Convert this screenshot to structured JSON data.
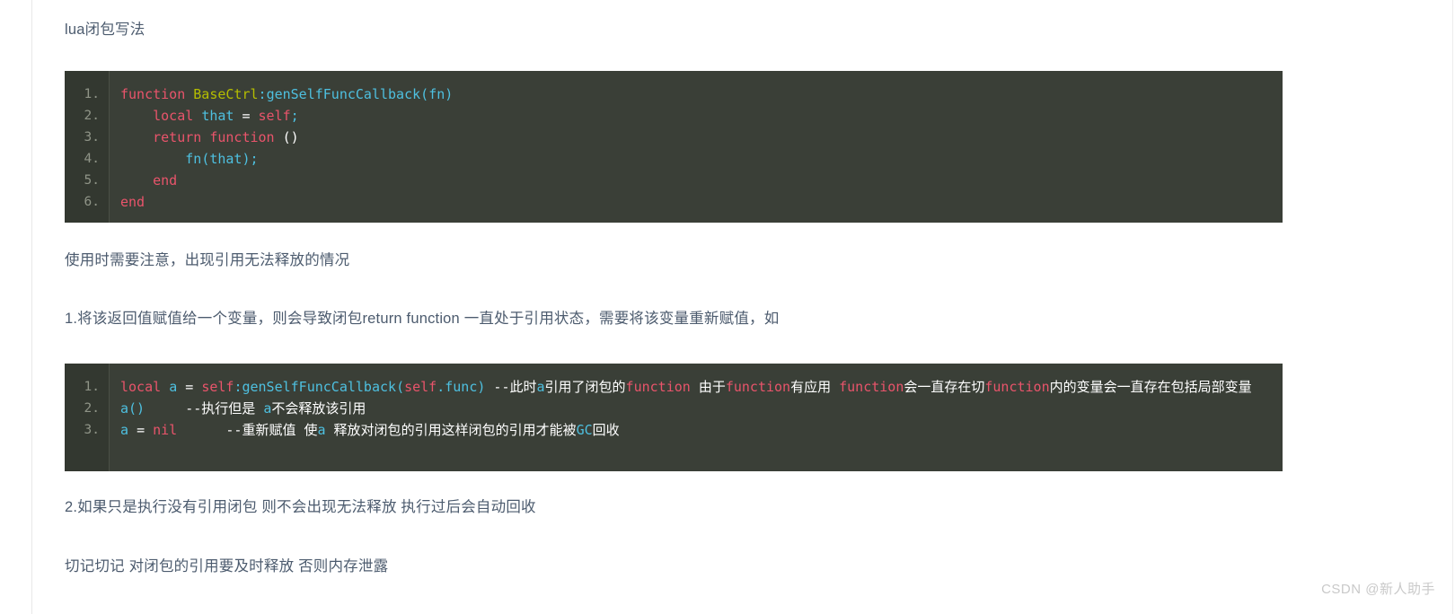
{
  "page": {
    "title": "lua闭包写法",
    "background": "#ffffff",
    "text_color": "#4c5b6e"
  },
  "paragraphs": {
    "title": "lua闭包写法",
    "note": "使用时需要注意，出现引用无法释放的情况",
    "item1": "1.将该返回值赋值给一个变量，则会导致闭包return function 一直处于引用状态，需要将该变量重新赋值，如",
    "item2": "2.如果只是执行没有引用闭包 则不会出现无法释放 执行过后会自动回收",
    "final": "切记切记 对闭包的引用要及时释放 否则内存泄露"
  },
  "code_blocks": [
    {
      "id": "code1",
      "language": "lua",
      "background": "#3a3f37",
      "gutter_background": "#333830",
      "line_numbers": [
        "1.",
        "2.",
        "3.",
        "4.",
        "5.",
        "6."
      ],
      "lines": [
        "function BaseCtrl:genSelfFuncCallback(fn)",
        "    local that = self;",
        "    return function ()",
        "        fn(that);",
        "    end",
        "end"
      ],
      "tokens": [
        [
          {
            "t": "function ",
            "c": "t-kw"
          },
          {
            "t": "BaseCtrl",
            "c": "t-type"
          },
          {
            "t": ":",
            "c": "t-punc"
          },
          {
            "t": "genSelfFuncCallback",
            "c": "t-fn"
          },
          {
            "t": "(",
            "c": "t-punc"
          },
          {
            "t": "fn",
            "c": "t-fn"
          },
          {
            "t": ")",
            "c": "t-punc"
          }
        ],
        [
          {
            "t": "    ",
            "c": "t-plain"
          },
          {
            "t": "local",
            "c": "t-kw"
          },
          {
            "t": " ",
            "c": "t-plain"
          },
          {
            "t": "that",
            "c": "t-fn"
          },
          {
            "t": " ",
            "c": "t-plain"
          },
          {
            "t": "=",
            "c": "t-plain"
          },
          {
            "t": " ",
            "c": "t-plain"
          },
          {
            "t": "self",
            "c": "t-self"
          },
          {
            "t": ";",
            "c": "t-punc"
          }
        ],
        [
          {
            "t": "    ",
            "c": "t-plain"
          },
          {
            "t": "return",
            "c": "t-kw"
          },
          {
            "t": " ",
            "c": "t-plain"
          },
          {
            "t": "function",
            "c": "t-kw"
          },
          {
            "t": " ",
            "c": "t-plain"
          },
          {
            "t": "()",
            "c": "t-plain"
          }
        ],
        [
          {
            "t": "        ",
            "c": "t-plain"
          },
          {
            "t": "fn",
            "c": "t-fn"
          },
          {
            "t": "(",
            "c": "t-punc"
          },
          {
            "t": "that",
            "c": "t-fn"
          },
          {
            "t": ")",
            "c": "t-punc"
          },
          {
            "t": ";",
            "c": "t-punc"
          }
        ],
        [
          {
            "t": "    ",
            "c": "t-plain"
          },
          {
            "t": "end",
            "c": "t-kw"
          }
        ],
        [
          {
            "t": "end",
            "c": "t-kw"
          }
        ]
      ]
    },
    {
      "id": "code2",
      "language": "lua",
      "background": "#3a3f37",
      "gutter_background": "#333830",
      "line_numbers": [
        "1.",
        "2.",
        "3."
      ],
      "lines": [
        "local a = self:genSelfFuncCallback(self.func) --此时a引用了闭包的function 由于function有应用 function会一直存在切function内的变量会一直存在包括局部变量",
        "a()     --执行但是 a不会释放该引用",
        "a = nil      --重新赋值 使a 释放对闭包的引用这样闭包的引用才能被GC回收"
      ],
      "tokens": [
        [
          {
            "t": "local",
            "c": "t-kw"
          },
          {
            "t": " ",
            "c": "t-plain"
          },
          {
            "t": "a",
            "c": "t-fn"
          },
          {
            "t": " ",
            "c": "t-plain"
          },
          {
            "t": "=",
            "c": "t-plain"
          },
          {
            "t": " ",
            "c": "t-plain"
          },
          {
            "t": "self",
            "c": "t-self"
          },
          {
            "t": ":",
            "c": "t-punc"
          },
          {
            "t": "genSelfFuncCallback",
            "c": "t-fn"
          },
          {
            "t": "(",
            "c": "t-punc"
          },
          {
            "t": "self",
            "c": "t-self"
          },
          {
            "t": ".",
            "c": "t-punc"
          },
          {
            "t": "func",
            "c": "t-fn"
          },
          {
            "t": ")",
            "c": "t-punc"
          },
          {
            "t": " --此时",
            "c": "t-comment"
          },
          {
            "t": "a",
            "c": "t-fn"
          },
          {
            "t": "引用了闭包的",
            "c": "t-comment"
          },
          {
            "t": "function",
            "c": "t-kw"
          },
          {
            "t": " 由于",
            "c": "t-comment"
          },
          {
            "t": "function",
            "c": "t-kw"
          },
          {
            "t": "有应用 ",
            "c": "t-comment"
          },
          {
            "t": "function",
            "c": "t-kw"
          },
          {
            "t": "会一直存在切",
            "c": "t-comment"
          },
          {
            "t": "function",
            "c": "t-kw"
          },
          {
            "t": "内的变量会一直存在包括局部变量",
            "c": "t-comment"
          }
        ],
        [
          {
            "t": "a",
            "c": "t-fn"
          },
          {
            "t": "()",
            "c": "t-punc"
          },
          {
            "t": "     --执行但是 ",
            "c": "t-comment"
          },
          {
            "t": "a",
            "c": "t-fn"
          },
          {
            "t": "不会释放该引用",
            "c": "t-comment"
          }
        ],
        [
          {
            "t": "a",
            "c": "t-fn"
          },
          {
            "t": " ",
            "c": "t-plain"
          },
          {
            "t": "=",
            "c": "t-plain"
          },
          {
            "t": " ",
            "c": "t-plain"
          },
          {
            "t": "nil",
            "c": "t-kw"
          },
          {
            "t": "      --重新赋值 使",
            "c": "t-comment"
          },
          {
            "t": "a",
            "c": "t-fn"
          },
          {
            "t": " 释放对闭包的引用这样闭包的引用才能被",
            "c": "t-comment"
          },
          {
            "t": "GC",
            "c": "t-gc"
          },
          {
            "t": "回收",
            "c": "t-comment"
          }
        ]
      ]
    }
  ],
  "watermark": {
    "text": "CSDN @新人助手"
  },
  "colors": {
    "code_bg": "#3a3f37",
    "gutter_bg": "#333830",
    "keyword": "#e9546b",
    "type": "#b5bd00",
    "identifier": "#4ec0e0",
    "comment": "#ffffff",
    "prose": "#4c5b6e",
    "watermark": "#c9c9c9"
  }
}
